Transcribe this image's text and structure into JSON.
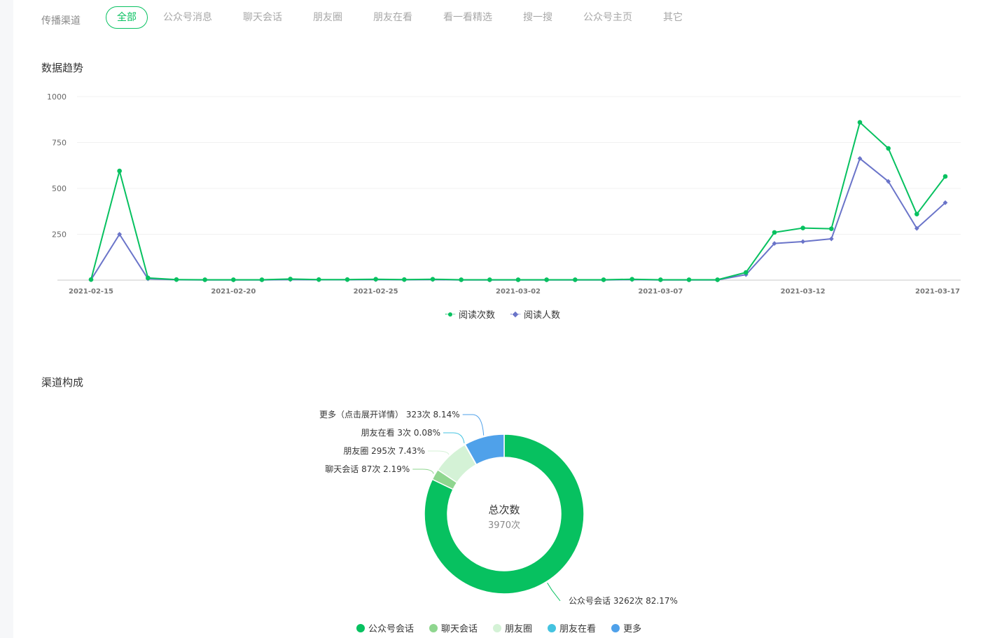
{
  "filter": {
    "label": "传播渠道",
    "tabs": [
      {
        "label": "全部",
        "active": true
      },
      {
        "label": "公众号消息",
        "active": false
      },
      {
        "label": "聊天会话",
        "active": false
      },
      {
        "label": "朋友圈",
        "active": false
      },
      {
        "label": "朋友在看",
        "active": false
      },
      {
        "label": "看一看精选",
        "active": false
      },
      {
        "label": "搜一搜",
        "active": false
      },
      {
        "label": "公众号主页",
        "active": false
      },
      {
        "label": "其它",
        "active": false
      }
    ]
  },
  "sections": {
    "trend_title": "数据趋势",
    "composition_title": "渠道构成"
  },
  "colors": {
    "accent": "#07c160",
    "reads_line": "#07c160",
    "readers_line": "#6a74c9",
    "gridline": "#f0f0f0",
    "axis": "#d9d9d9"
  },
  "chart_data": [
    {
      "type": "line",
      "title": "",
      "x": [
        "2021-02-15",
        "2021-02-16",
        "2021-02-17",
        "2021-02-18",
        "2021-02-19",
        "2021-02-20",
        "2021-02-21",
        "2021-02-22",
        "2021-02-23",
        "2021-02-24",
        "2021-02-25",
        "2021-02-26",
        "2021-02-27",
        "2021-02-28",
        "2021-03-01",
        "2021-03-02",
        "2021-03-03",
        "2021-03-04",
        "2021-03-05",
        "2021-03-06",
        "2021-03-07",
        "2021-03-08",
        "2021-03-09",
        "2021-03-10",
        "2021-03-11",
        "2021-03-12",
        "2021-03-13",
        "2021-03-14",
        "2021-03-15",
        "2021-03-16",
        "2021-03-17"
      ],
      "x_tick_labels": [
        "2021-02-15",
        "2021-02-20",
        "2021-02-25",
        "2021-03-02",
        "2021-03-07",
        "2021-03-12",
        "2021-03-17"
      ],
      "ylim": [
        0,
        1000
      ],
      "y_ticks": [
        250,
        500,
        750,
        1000
      ],
      "grid": true,
      "legend_position": "bottom",
      "series": [
        {
          "name": "阅读次数",
          "color": "#07c160",
          "marker": "circle",
          "values": [
            3,
            595,
            12,
            3,
            2,
            2,
            2,
            6,
            3,
            3,
            5,
            3,
            5,
            2,
            2,
            2,
            2,
            2,
            2,
            5,
            2,
            2,
            2,
            42,
            260,
            284,
            280,
            860,
            718,
            360,
            565
          ]
        },
        {
          "name": "阅读人数",
          "color": "#6a74c9",
          "marker": "diamond",
          "values": [
            2,
            250,
            7,
            2,
            1,
            1,
            1,
            3,
            2,
            2,
            3,
            2,
            3,
            1,
            1,
            1,
            1,
            1,
            1,
            3,
            1,
            1,
            1,
            30,
            200,
            210,
            225,
            663,
            538,
            282,
            422
          ]
        }
      ]
    },
    {
      "type": "pie",
      "title": "",
      "center_label": "总次数",
      "center_value": "3970次",
      "legend_position": "bottom",
      "slices": [
        {
          "name": "公众号会话",
          "label": "公众号会话 3262次 82.17%",
          "value": 3262,
          "percent": 82.17,
          "color": "#07c160"
        },
        {
          "name": "聊天会话",
          "label": "聊天会话 87次 2.19%",
          "value": 87,
          "percent": 2.19,
          "color": "#8fd68f"
        },
        {
          "name": "朋友圈",
          "label": "朋友圈 295次 7.43%",
          "value": 295,
          "percent": 7.43,
          "color": "#d4f2d6"
        },
        {
          "name": "朋友在看",
          "label": "朋友在看 3次 0.08%",
          "value": 3,
          "percent": 0.08,
          "color": "#44c3e0"
        },
        {
          "name": "更多",
          "label": "更多（点击展开详情） 323次 8.14%",
          "value": 323,
          "percent": 8.14,
          "color": "#4fa1ea"
        }
      ]
    }
  ]
}
